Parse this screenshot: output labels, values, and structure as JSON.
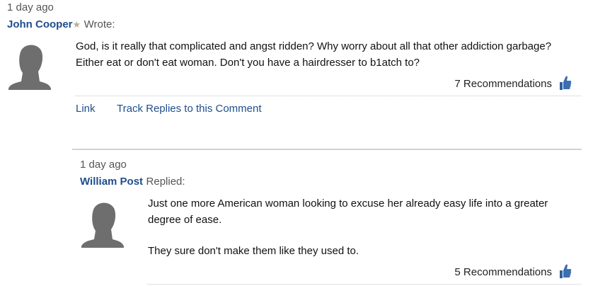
{
  "comment": {
    "timestamp": "1 day ago",
    "author": "John Cooper",
    "badge_icon": "star-icon",
    "verb": "Wrote:",
    "avatar_icon": "default-avatar-icon",
    "text": "God, is it really that complicated and angst ridden? Why worry about all that other addiction garbage? Either eat or don't eat woman. Don't you have a hairdresser to b1atch to?",
    "recommendations": "7 Recommendations",
    "recommend_icon": "thumbs-up-icon",
    "actions": {
      "link": "Link",
      "track": "Track Replies to this Comment"
    }
  },
  "reply": {
    "timestamp": "1 day ago",
    "author": "William Post",
    "verb": "Replied:",
    "avatar_icon": "default-avatar-icon",
    "paragraphs": [
      "Just one more American woman looking to excuse her already easy life into a greater degree of ease.",
      "They sure don't make them like they used to."
    ],
    "recommendations": "5 Recommendations",
    "recommend_icon": "thumbs-up-icon"
  },
  "colors": {
    "author_link": "#1f4e8c",
    "badge": "#b9ad93",
    "thumb": "#3b6fb0",
    "avatar": "#6a6a6a"
  }
}
